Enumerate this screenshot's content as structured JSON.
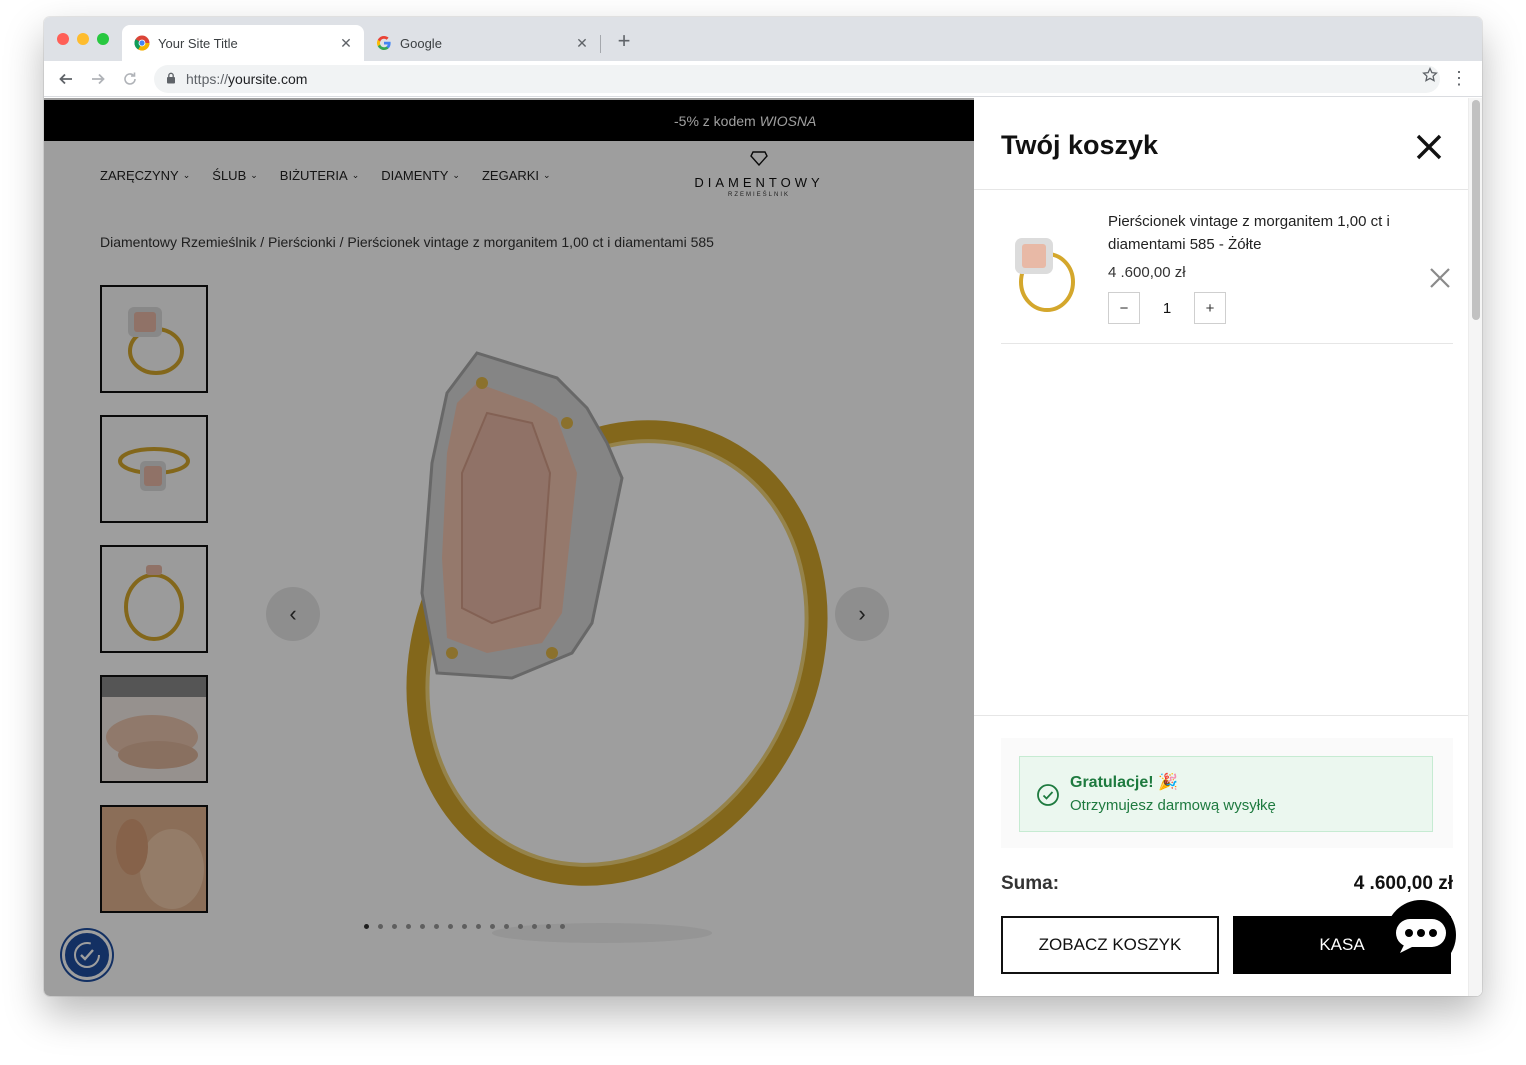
{
  "browser": {
    "tabs": [
      {
        "title": "Your Site Title",
        "active": true
      },
      {
        "title": "Google",
        "active": false
      }
    ],
    "url_scheme": "https://",
    "url_host": "yoursite.com"
  },
  "promo": {
    "prefix": "-5% z kodem ",
    "code": "WIOSNA"
  },
  "nav": {
    "items": [
      "ZARĘCZYNY",
      "ŚLUB",
      "BIŻUTERIA",
      "DIAMENTY",
      "ZEGARKI"
    ]
  },
  "logo": {
    "brand": "DIAMENTOWY",
    "sub": "RZEMIEŚLNIK"
  },
  "breadcrumb": "Diamentowy Rzemieślnik / Pierścionki / Pierścionek vintage z morganitem 1,00 ct i diamentami 585",
  "gallery": {
    "thumbnail_count": 5,
    "dot_count": 15,
    "active_dot": 0
  },
  "cart": {
    "title": "Twój koszyk",
    "item": {
      "name": "Pierścionek vintage z morganitem 1,00 ct i diamentami 585 - Żółte",
      "price": "4 .600,00 zł",
      "quantity": "1",
      "minus": "−",
      "plus": "+"
    },
    "notice": {
      "title": "Gratulacje! 🎉",
      "text": "Otrzymujesz darmową wysyłkę"
    },
    "sum_label": "Suma:",
    "sum_value": "4 .600,00 zł",
    "view_cart_label": "ZOBACZ KOSZYK",
    "checkout_label": "KASA"
  },
  "colors": {
    "promo_bg": "#000000",
    "notice_green": "#1e7a3f",
    "a11y_blue": "#1f4ea1",
    "gold": "#d4a72c",
    "morganite": "#e8b9a6"
  }
}
